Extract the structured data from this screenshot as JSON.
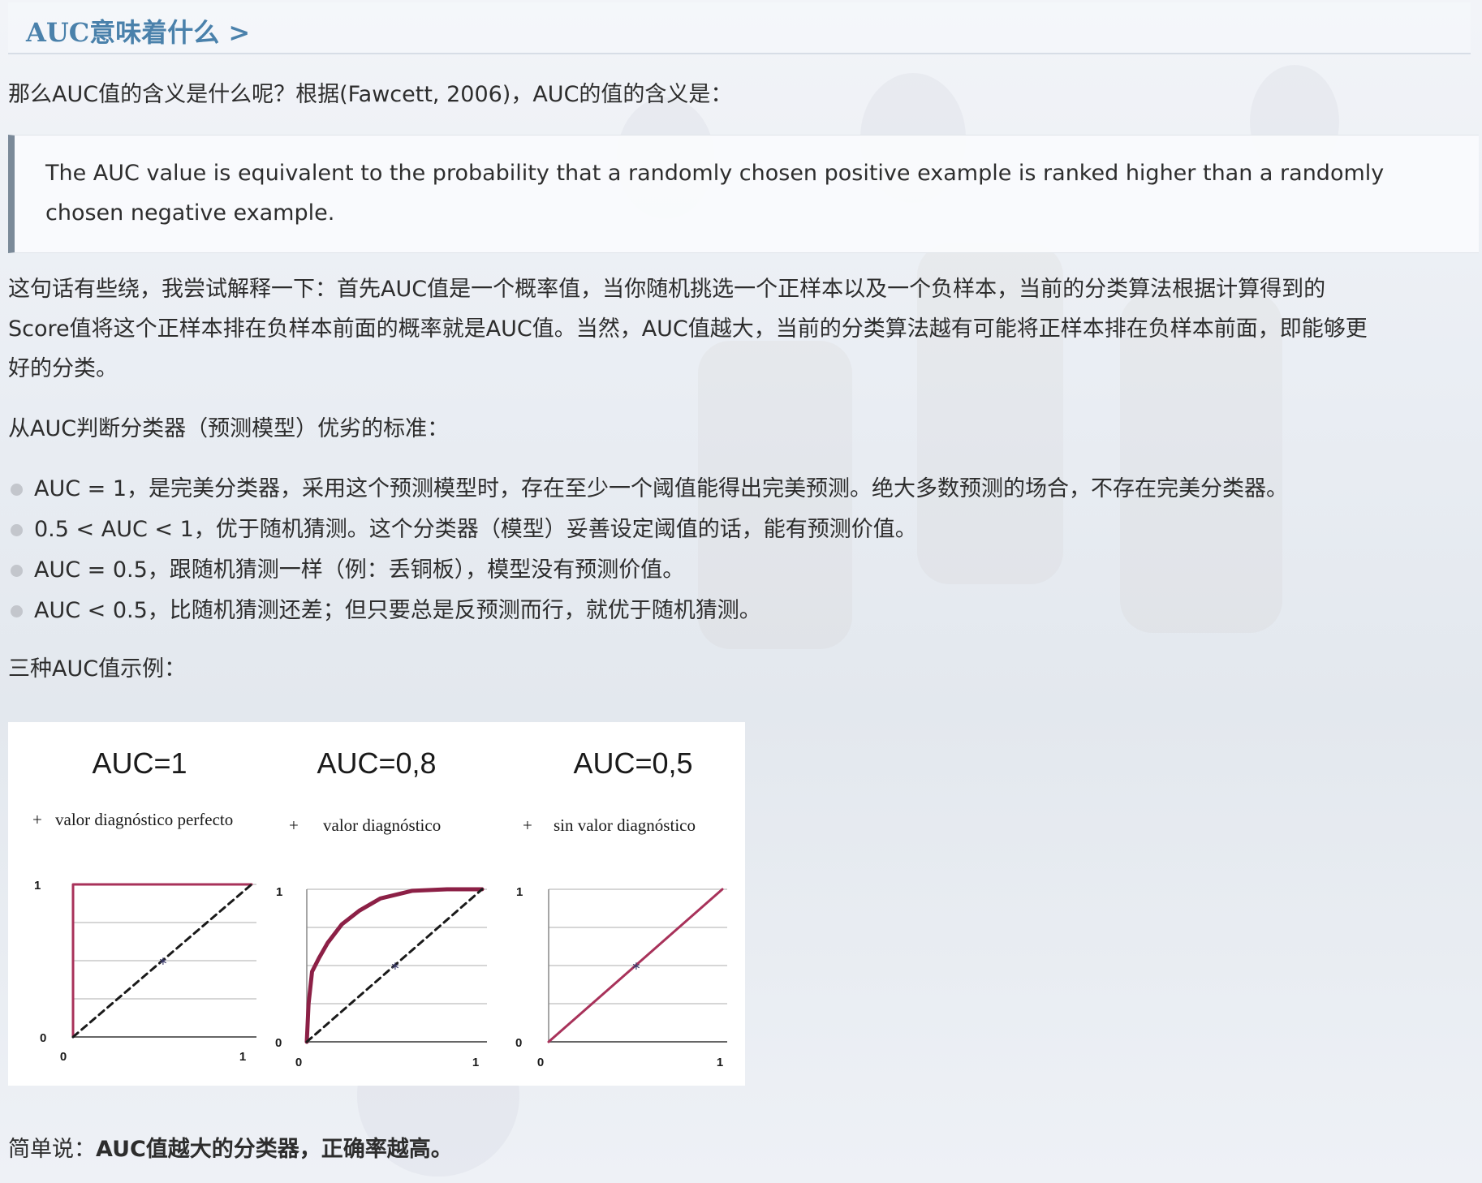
{
  "heading": {
    "title": "AUC意味着什么 >"
  },
  "intro": "那么AUC值的含义是什么呢？根据(Fawcett, 2006)，AUC的值的含义是：",
  "quote": {
    "line1": "The AUC value is equivalent to the probability that a randomly chosen positive example is ranked higher than a randomly",
    "line2": "chosen negative example."
  },
  "explanation": {
    "line1": "这句话有些绕，我尝试解释一下：首先AUC值是一个概率值，当你随机挑选一个正样本以及一个负样本，当前的分类算法根据计算得到的",
    "line2": "Score值将这个正样本排在负样本前面的概率就是AUC值。当然，AUC值越大，当前的分类算法越有可能将正样本排在负样本前面，即能够更",
    "line3": "好的分类。"
  },
  "criteria_intro": "从AUC判断分类器（预测模型）优劣的标准：",
  "criteria": [
    "AUC = 1，是完美分类器，采用这个预测模型时，存在至少一个阈值能得出完美预测。绝大多数预测的场合，不存在完美分类器。",
    "0.5 < AUC < 1，优于随机猜测。这个分类器（模型）妥善设定阈值的话，能有预测价值。",
    "AUC = 0.5，跟随机猜测一样（例：丢铜板），模型没有预测价值。",
    "AUC < 0.5，比随机猜测还差；但只要总是反预测而行，就优于随机猜测。"
  ],
  "examples_intro": "三种AUC值示例：",
  "chart_data": [
    {
      "type": "line",
      "title": "AUC=1",
      "subtitle": "valor diagnóstico perfecto",
      "plus": "+",
      "x_ticks": [
        "0",
        "1"
      ],
      "y_ticks": [
        "0",
        "1"
      ],
      "xlim": [
        0,
        1
      ],
      "ylim": [
        0,
        1
      ],
      "grid": true,
      "series": [
        {
          "style": "solid",
          "color": "#a8325a",
          "x": [
            0,
            0,
            1
          ],
          "y": [
            0,
            1,
            1
          ]
        },
        {
          "style": "dashed",
          "color": "#1a1a1a",
          "x": [
            0,
            1
          ],
          "y": [
            0,
            1
          ]
        }
      ]
    },
    {
      "type": "line",
      "title": "AUC=0,8",
      "subtitle": "valor diagnóstico",
      "plus": "+",
      "x_ticks": [
        "0",
        "1"
      ],
      "y_ticks": [
        "1",
        "0"
      ],
      "xlim": [
        0,
        1
      ],
      "ylim": [
        0,
        1
      ],
      "grid": true,
      "series": [
        {
          "style": "solid",
          "color": "#8c2046",
          "x": [
            0,
            0.01,
            0.03,
            0.07,
            0.12,
            0.2,
            0.3,
            0.42,
            0.6,
            0.8,
            1
          ],
          "y": [
            0,
            0.25,
            0.46,
            0.55,
            0.65,
            0.77,
            0.86,
            0.94,
            0.99,
            1,
            1
          ]
        },
        {
          "style": "dashed",
          "color": "#1a1a1a",
          "x": [
            0,
            1
          ],
          "y": [
            0,
            1
          ]
        }
      ]
    },
    {
      "type": "line",
      "title": "AUC=0,5",
      "subtitle": "sin valor diagnóstico",
      "plus": "+",
      "x_ticks": [
        "0",
        "1"
      ],
      "y_ticks": [
        "1",
        "0"
      ],
      "xlim": [
        0,
        1
      ],
      "ylim": [
        0,
        1
      ],
      "grid": true,
      "series": [
        {
          "style": "solid",
          "color": "#a8325a",
          "x": [
            0,
            1
          ],
          "y": [
            0,
            1
          ]
        }
      ]
    }
  ],
  "conclusion": {
    "prefix": "简单说：",
    "bold": "AUC值越大的分类器，正确率越高。"
  }
}
